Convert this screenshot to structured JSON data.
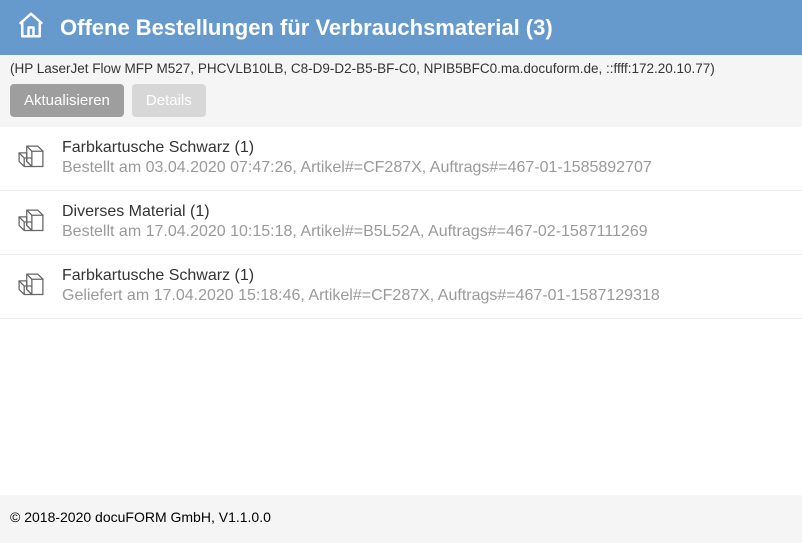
{
  "header": {
    "title": "Offene Bestellungen für Verbrauchsmaterial (3)"
  },
  "device_info": "(HP LaserJet Flow MFP M527, PHCVLB10LB, C8-D9-D2-B5-BF-C0, NPIB5BFC0.ma.docuform.de, ::ffff:172.20.10.77)",
  "toolbar": {
    "refresh_label": "Aktualisieren",
    "details_label": "Details"
  },
  "orders": [
    {
      "title": "Farbkartusche Schwarz (1)",
      "detail": "Bestellt am 03.04.2020 07:47:26, Artikel#=CF287X, Auftrags#=467-01-1585892707"
    },
    {
      "title": "Diverses Material (1)",
      "detail": "Bestellt am 17.04.2020 10:15:18, Artikel#=B5L52A, Auftrags#=467-02-1587111269"
    },
    {
      "title": "Farbkartusche Schwarz (1)",
      "detail": "Geliefert am 17.04.2020 15:18:46, Artikel#=CF287X, Auftrags#=467-01-1587129318"
    }
  ],
  "footer": "© 2018-2020 docuFORM GmbH, V1.1.0.0"
}
